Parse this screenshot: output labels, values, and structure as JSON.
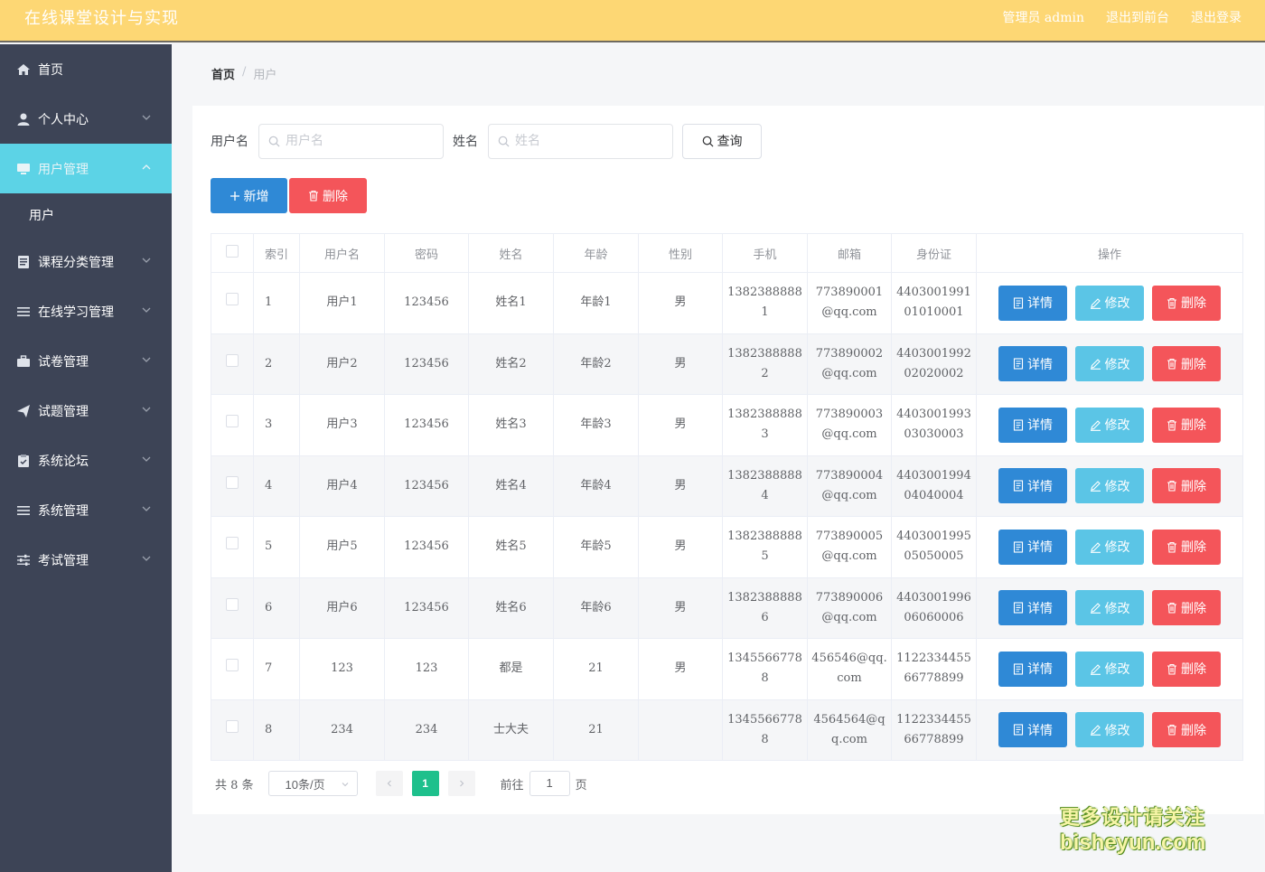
{
  "header": {
    "title": "在线课堂设计与实现",
    "links": [
      "管理员 admin",
      "退出到前台",
      "退出登录"
    ]
  },
  "sidebar": {
    "items": [
      {
        "label": "首页",
        "icon": "home-icon"
      },
      {
        "label": "个人中心",
        "icon": "user-icon"
      },
      {
        "label": "用户管理",
        "icon": "monitor-icon"
      },
      {
        "label": "课程分类管理",
        "icon": "document-icon"
      },
      {
        "label": "在线学习管理",
        "icon": "menu-icon"
      },
      {
        "label": "试卷管理",
        "icon": "briefcase-icon"
      },
      {
        "label": "试题管理",
        "icon": "send-icon"
      },
      {
        "label": "系统论坛",
        "icon": "clipboard-icon"
      },
      {
        "label": "系统管理",
        "icon": "menu-icon"
      },
      {
        "label": "考试管理",
        "icon": "sliders-icon"
      }
    ],
    "sub_item": "用户"
  },
  "breadcrumb": {
    "home": "首页",
    "sep": "/",
    "current": "用户"
  },
  "search": {
    "username_label": "用户名",
    "username_placeholder": "用户名",
    "name_label": "姓名",
    "name_placeholder": "姓名",
    "query_label": "查询"
  },
  "actions": {
    "add_label": "新增",
    "delete_label": "删除"
  },
  "table": {
    "headers": [
      "索引",
      "用户名",
      "密码",
      "姓名",
      "年龄",
      "性别",
      "手机",
      "邮箱",
      "身份证",
      "操作"
    ],
    "rows": [
      {
        "index": "1",
        "username": "用户1",
        "password": "123456",
        "name": "姓名1",
        "age": "年龄1",
        "gender": "男",
        "phone": [
          "1382388888",
          "1"
        ],
        "email": [
          "773890001",
          "@qq.com"
        ],
        "idcard": [
          "4403001991",
          "01010001"
        ]
      },
      {
        "index": "2",
        "username": "用户2",
        "password": "123456",
        "name": "姓名2",
        "age": "年龄2",
        "gender": "男",
        "phone": [
          "1382388888",
          "2"
        ],
        "email": [
          "773890002",
          "@qq.com"
        ],
        "idcard": [
          "4403001992",
          "02020002"
        ]
      },
      {
        "index": "3",
        "username": "用户3",
        "password": "123456",
        "name": "姓名3",
        "age": "年龄3",
        "gender": "男",
        "phone": [
          "1382388888",
          "3"
        ],
        "email": [
          "773890003",
          "@qq.com"
        ],
        "idcard": [
          "4403001993",
          "03030003"
        ]
      },
      {
        "index": "4",
        "username": "用户4",
        "password": "123456",
        "name": "姓名4",
        "age": "年龄4",
        "gender": "男",
        "phone": [
          "1382388888",
          "4"
        ],
        "email": [
          "773890004",
          "@qq.com"
        ],
        "idcard": [
          "4403001994",
          "04040004"
        ]
      },
      {
        "index": "5",
        "username": "用户5",
        "password": "123456",
        "name": "姓名5",
        "age": "年龄5",
        "gender": "男",
        "phone": [
          "1382388888",
          "5"
        ],
        "email": [
          "773890005",
          "@qq.com"
        ],
        "idcard": [
          "4403001995",
          "05050005"
        ]
      },
      {
        "index": "6",
        "username": "用户6",
        "password": "123456",
        "name": "姓名6",
        "age": "年龄6",
        "gender": "男",
        "phone": [
          "1382388888",
          "6"
        ],
        "email": [
          "773890006",
          "@qq.com"
        ],
        "idcard": [
          "4403001996",
          "06060006"
        ]
      },
      {
        "index": "7",
        "username": "123",
        "password": "123",
        "name": "都是",
        "age": "21",
        "gender": "男",
        "phone": [
          "1345566778",
          "8"
        ],
        "email": [
          "456546@qq.",
          "com"
        ],
        "idcard": [
          "1122334455",
          "66778899"
        ]
      },
      {
        "index": "8",
        "username": "234",
        "password": "234",
        "name": "士大夫",
        "age": "21",
        "gender": "",
        "phone": [
          "1345566778",
          "8"
        ],
        "email": [
          "4564564@q",
          "q.com"
        ],
        "idcard": [
          "1122334455",
          "66778899"
        ]
      }
    ],
    "row_actions": {
      "detail": "详情",
      "edit": "修改",
      "delete": "删除"
    }
  },
  "pagination": {
    "total": "共 8 条",
    "page_size": "10条/页",
    "current_page": "1",
    "goto_label": "前往",
    "goto_value": "1",
    "page_unit": "页"
  },
  "watermark": {
    "line1": "更多设计请关注",
    "line2": "bisheyun.com"
  },
  "colors": {
    "header_bg": "#fdd774",
    "sidebar_bg": "#3d4456",
    "sidebar_active": "#5cd3e6",
    "primary_blue": "#2f89d6",
    "cyan": "#5bc5e6",
    "danger_red": "#f4555a",
    "pager_active": "#1ec08c"
  }
}
